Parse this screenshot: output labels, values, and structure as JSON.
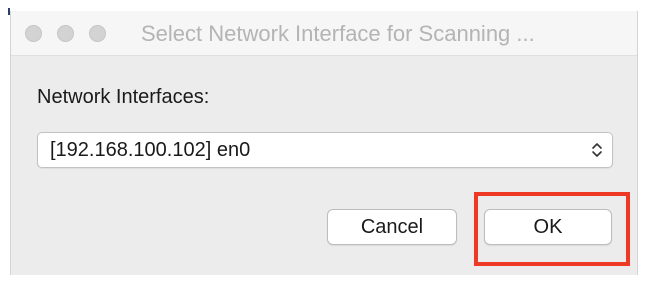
{
  "window": {
    "title": "Select Network Interface for Scanning ..."
  },
  "form": {
    "label": "Network Interfaces:",
    "selected_interface": "[192.168.100.102] en0"
  },
  "buttons": {
    "cancel_label": "Cancel",
    "ok_label": "OK"
  },
  "colors": {
    "highlight": "#ee3a24",
    "window_bg": "#ececec",
    "titlebar_bg": "#f6f6f6"
  },
  "icons": {
    "window_controls": [
      "close-icon",
      "minimize-icon",
      "zoom-icon"
    ],
    "select_arrows": "updown-chevron-icon"
  }
}
